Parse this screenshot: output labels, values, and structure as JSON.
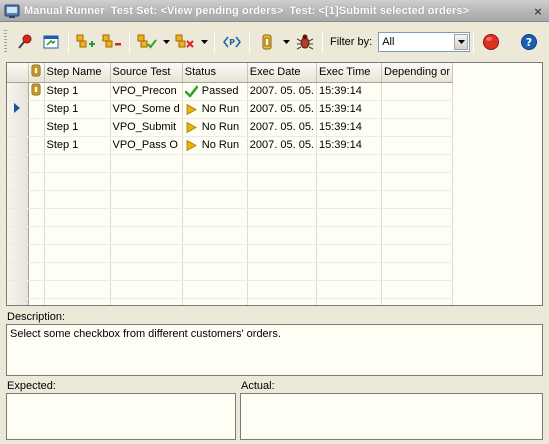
{
  "window": {
    "app_title": "Manual Runner",
    "test_set_label": "Test Set:",
    "test_set_value": "<View pending orders>",
    "test_label": "Test:",
    "test_value": "<[1]Submit selected orders>",
    "close_glyph": "×"
  },
  "toolbar": {
    "filter_label": "Filter by:",
    "filter_value": "All"
  },
  "grid": {
    "columns": [
      "Step Name",
      "Source Test",
      "Status",
      "Exec Date",
      "Exec Time",
      "Depending or"
    ],
    "rows": [
      {
        "name": "Step 1",
        "source": "VPO_Precon",
        "status": "Passed",
        "date": "2007. 05. 05.",
        "time": "15:39:14",
        "depending": "",
        "status_icon": "check-icon",
        "row_icon": "test-step-icon",
        "current": false
      },
      {
        "name": "Step 1",
        "source": "VPO_Some d",
        "status": "No Run",
        "date": "2007. 05. 05.",
        "time": "15:39:14",
        "depending": "",
        "status_icon": "norun-icon",
        "row_icon": "",
        "current": true
      },
      {
        "name": "Step 1",
        "source": "VPO_Submit",
        "status": "No Run",
        "date": "2007. 05. 05.",
        "time": "15:39:14",
        "depending": "",
        "status_icon": "norun-icon",
        "row_icon": "",
        "current": false
      },
      {
        "name": "Step 1",
        "source": "VPO_Pass O",
        "status": "No Run",
        "date": "2007. 05. 05.",
        "time": "15:39:14",
        "depending": "",
        "status_icon": "norun-icon",
        "row_icon": "",
        "current": false
      }
    ]
  },
  "description": {
    "label": "Description:",
    "text": "Select some checkbox from different customers' orders."
  },
  "expected": {
    "label": "Expected:",
    "text": ""
  },
  "actual": {
    "label": "Actual:",
    "text": ""
  },
  "colors": {
    "passed": "#2ea52e",
    "norun": "#e8b400",
    "stop": "#e03020",
    "help": "#1a5fb4",
    "panel_bg": "#fffef4"
  }
}
